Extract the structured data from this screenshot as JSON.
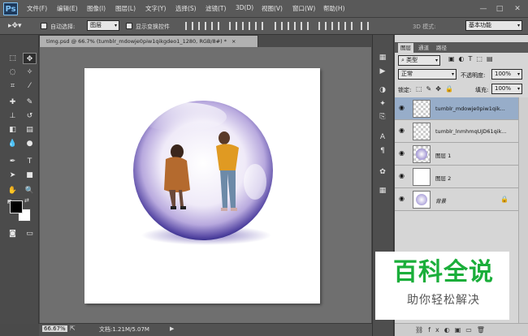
{
  "app": {
    "logo": "Ps"
  },
  "menu": [
    "文件(F)",
    "编辑(E)",
    "图像(I)",
    "图层(L)",
    "文字(Y)",
    "选择(S)",
    "滤镜(T)",
    "3D(D)",
    "视图(V)",
    "窗口(W)",
    "帮助(H)"
  ],
  "window_controls": {
    "minimize": "—",
    "maximize": "□",
    "close": "✕"
  },
  "options": {
    "auto_select_label": "自动选择:",
    "auto_select_value": "图层",
    "show_transform_label": "显示变换控件",
    "mode_3d_label": "3D 模式:",
    "workspace": "基本功能"
  },
  "doc_tab": {
    "title": "timg.psd @ 66.7% (tumblr_mdowje0piw1qikgdeo1_1280, RGB/8#) *",
    "close": "×"
  },
  "status": {
    "zoom": "66.67%",
    "doc_size": "文档:1.21M/5.07M"
  },
  "panel_tabs": [
    "图层",
    "通道",
    "路径"
  ],
  "layers_panel": {
    "filter_kind": "类型",
    "blend_mode": "正常",
    "opacity_label": "不透明度:",
    "opacity_value": "100%",
    "lock_label": "锁定:",
    "fill_label": "填充:",
    "fill_value": "100%"
  },
  "layers": [
    {
      "name": "tumblr_mdowje0piw1qik...",
      "selected": true
    },
    {
      "name": "tumblr_lnmhmqUJD61qik...",
      "selected": false
    },
    {
      "name": "图层 1",
      "selected": false
    },
    {
      "name": "图层 2",
      "selected": false
    },
    {
      "name": "背景",
      "selected": false
    }
  ],
  "watermark": {
    "title": "百科全说",
    "subtitle": "助你轻松解决"
  },
  "colors": {
    "menubar": "#595959",
    "canvas_bg": "#6f6f6f",
    "panel_bg": "#d6d6d6",
    "selected_layer": "#97adc9",
    "watermark_green": "#1aae3a"
  }
}
